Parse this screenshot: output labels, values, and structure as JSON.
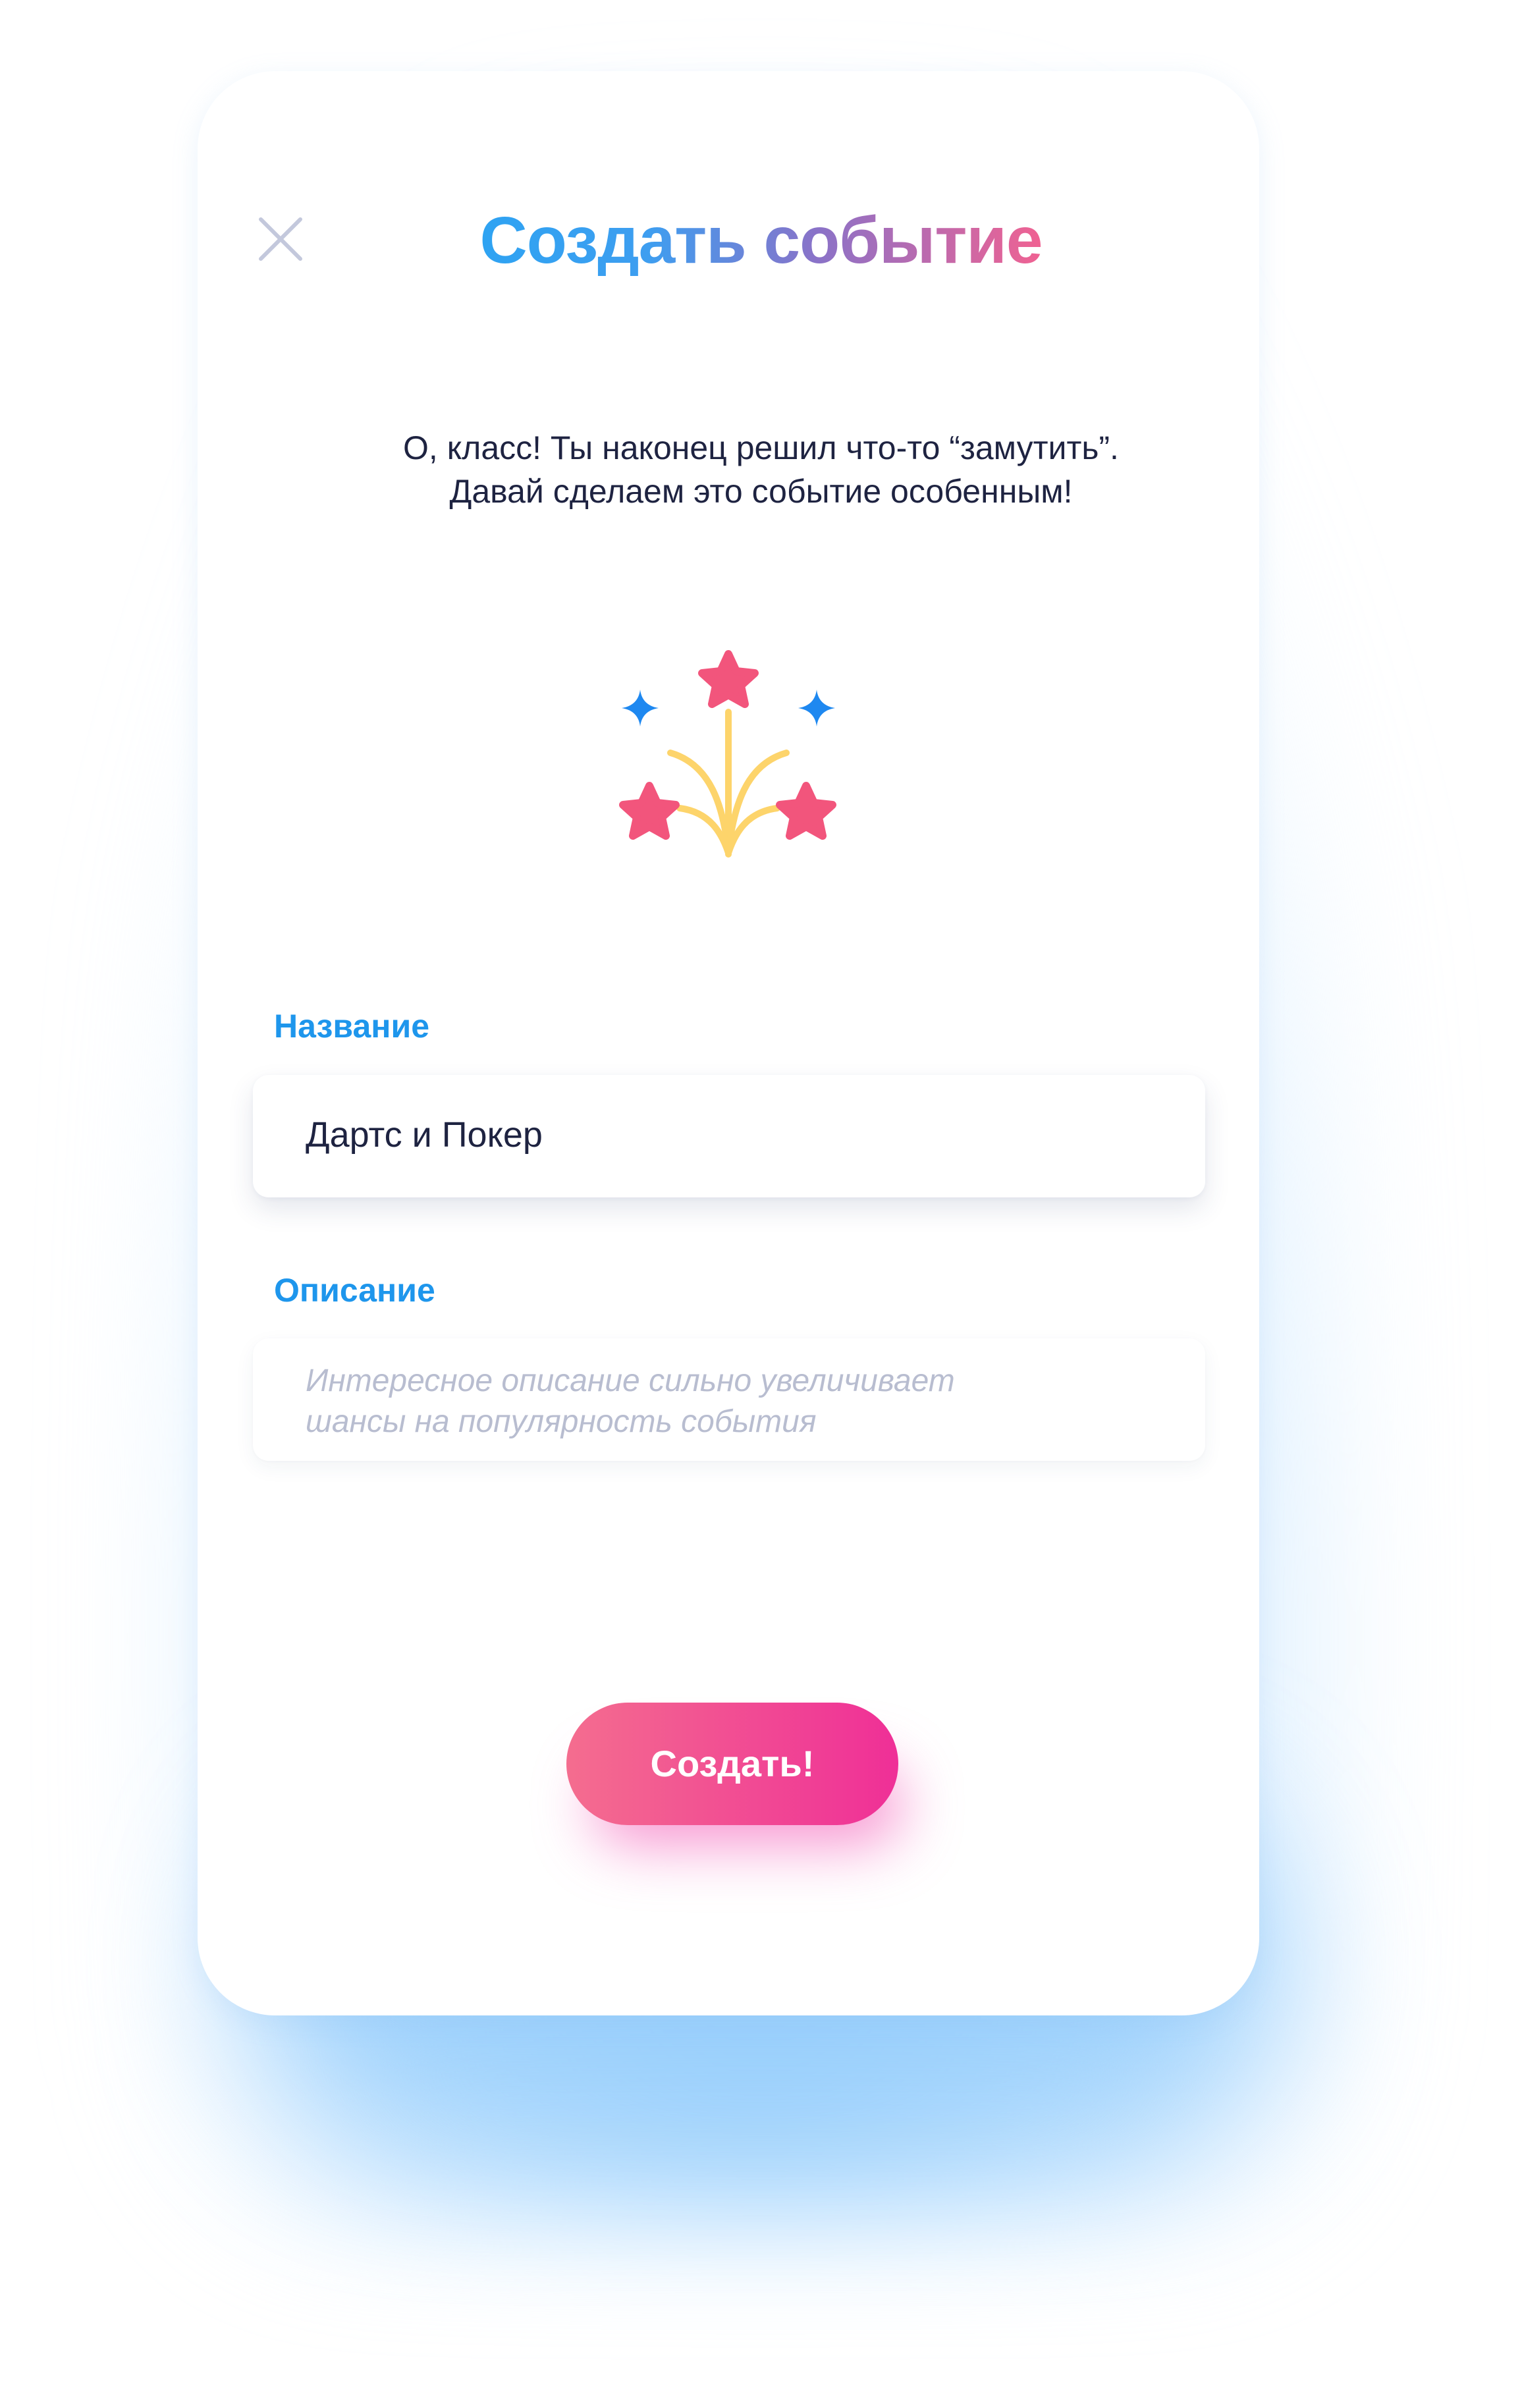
{
  "header": {
    "title": "Создать событие",
    "close_icon": "close-icon"
  },
  "intro": {
    "line1": "О, класс!  Ты наконец решил что-то “замутить”.",
    "line2": "Давай сделаем это событие особенным!"
  },
  "illustration": {
    "icon": "fireworks-icon",
    "colors": {
      "star": "#f2557c",
      "sparkle": "#1e88f0",
      "stream": "#fdd46b"
    }
  },
  "form": {
    "name": {
      "label": "Название",
      "value": "Дартс и Покер"
    },
    "description": {
      "label": "Описание",
      "placeholder_line1": "Интересное описание сильно увеличивает",
      "placeholder_line2": "шансы на популярность события",
      "value": ""
    }
  },
  "actions": {
    "create_label": "Создать!"
  },
  "colors": {
    "accent_blue": "#1e96ec",
    "text_dark": "#1e2341",
    "button_gradient_start": "#f46d8f",
    "button_gradient_end": "#ef2f97",
    "glow": "#b9dffd"
  }
}
